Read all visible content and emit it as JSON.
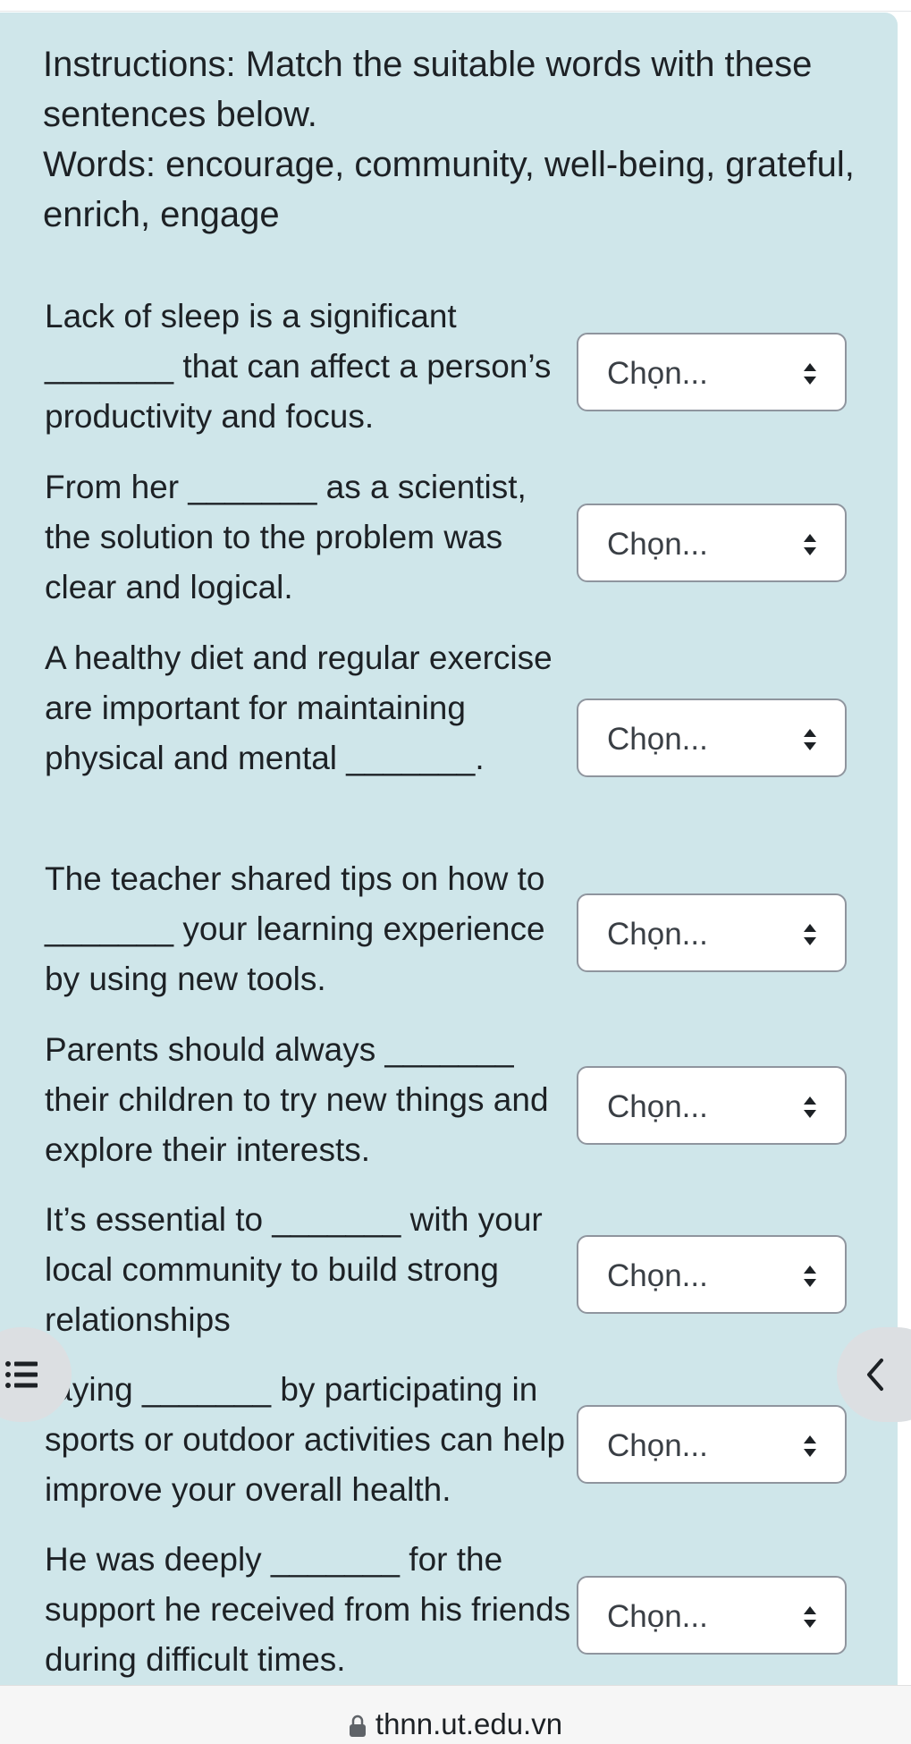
{
  "instructions": {
    "line1": "Instructions: Match the suitable words with these sentences below.",
    "line2": "Words: encourage, community, well-being, grateful, enrich, engage"
  },
  "questions": [
    {
      "text": "Lack of sleep is a significant _______ that can affect a person’s productivity and focus.",
      "select_value": "Chọn..."
    },
    {
      "text": "From her _______ as a scientist, the solution to the problem was clear and logical.",
      "select_value": "Chọn..."
    },
    {
      "text": "A healthy diet and regular exercise are important for maintaining physical and mental _______.",
      "select_value": "Chọn..."
    },
    {
      "text": "The teacher shared tips on how to _______ your learning experience by using new tools.",
      "select_value": "Chọn..."
    },
    {
      "text": "Parents should always _______ their children to try new things and explore their interests.",
      "select_value": "Chọn..."
    },
    {
      "text": "It’s essential to _______ with your local community to build strong relationships",
      "select_value": "Chọn..."
    },
    {
      "text": "taying _______ by participating in sports or outdoor activities can help improve your overall health.",
      "select_value": "Chọn..."
    },
    {
      "text": "He was deeply _______ for the support he received from his friends during difficult times.",
      "select_value": "Chọn..."
    }
  ],
  "footer": {
    "url": "thnn.ut.edu.vn"
  },
  "icons": {
    "list": "list-icon",
    "chevron": "chevron-left-icon",
    "lock": "lock-icon",
    "select_arrows": "sort-arrows-icon"
  },
  "colors": {
    "card_background": "#cfe6ea",
    "select_border": "#8f959e"
  }
}
